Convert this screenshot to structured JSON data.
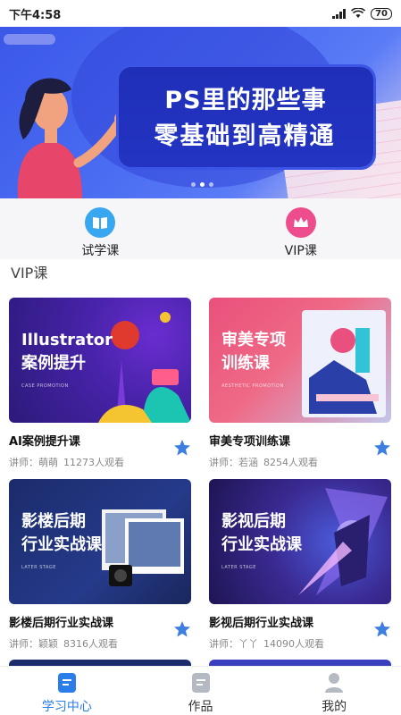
{
  "status": {
    "time": "下午4:58",
    "battery": "70"
  },
  "banner": {
    "line1": "PS里的那些事",
    "line2": "零基础到高精通",
    "active_dot": 1,
    "dot_count": 3
  },
  "quick_nav": [
    {
      "label": "试学课",
      "icon": "book-icon",
      "color": "#39a7f0"
    },
    {
      "label": "VIP课",
      "icon": "crown-icon",
      "color": "#ee4d8d"
    }
  ],
  "section": {
    "title": "VIP课"
  },
  "courses": [
    {
      "title": "AI案例提升课",
      "thumb_l1": "Illustrator",
      "thumb_l2": "案例提升",
      "thumb_sub": "CASE PROMOTION",
      "teacher": "讲师：萌萌",
      "views": "11273人观看"
    },
    {
      "title": "审美专项训练课",
      "thumb_l1": "审美专项",
      "thumb_l2": "训练课",
      "thumb_sub": "AESTHETIC PROMOTION",
      "teacher": "讲师：若涵",
      "views": "8254人观看"
    },
    {
      "title": "影楼后期行业实战课",
      "thumb_l1": "影楼后期",
      "thumb_l2": "行业实战课",
      "thumb_sub": "LATER STAGE",
      "teacher": "讲师：颖颖",
      "views": "8316人观看"
    },
    {
      "title": "影视后期行业实战课",
      "thumb_l1": "影视后期",
      "thumb_l2": "行业实战课",
      "thumb_sub": "LATER STAGE",
      "teacher": "讲师：丫丫",
      "views": "14090人观看"
    }
  ],
  "tabbar": [
    {
      "label": "学习中心",
      "icon": "study-icon",
      "active": true
    },
    {
      "label": "作品",
      "icon": "works-icon",
      "active": false
    },
    {
      "label": "我的",
      "icon": "profile-icon",
      "active": false
    }
  ],
  "colors": {
    "accent": "#2b7de9",
    "star": "#3d7ee0"
  }
}
